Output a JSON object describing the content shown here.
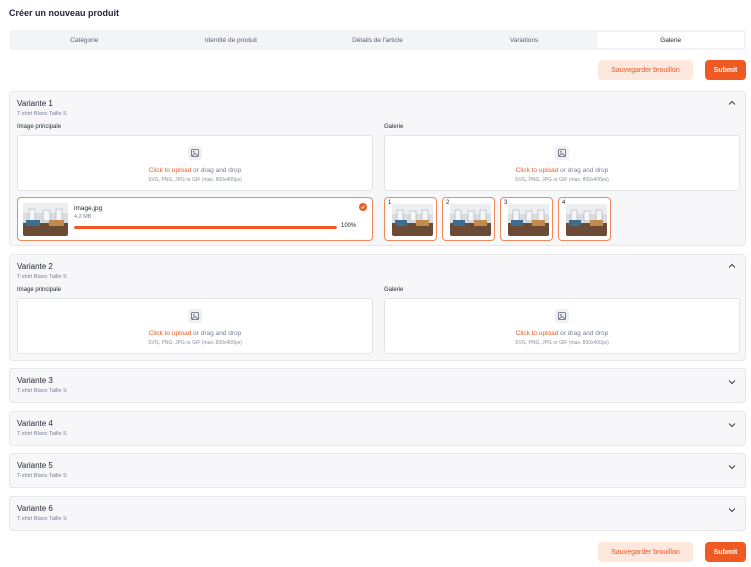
{
  "page": {
    "title": "Créer un nouveau produit"
  },
  "tabs": [
    "Catégorie",
    "Identité de produit",
    "Détails de l'article",
    "Variations",
    "Galerie"
  ],
  "actions": {
    "draft": "Sauvegarder brouillon",
    "submit": "Submit"
  },
  "upload": {
    "cta": "Click to upload",
    "rest": " or drag and drop",
    "hint": "SVG, PNG, JPG or GIF (max. 800x400px)"
  },
  "labels": {
    "main_image": "Image principale",
    "gallery": "Galerie"
  },
  "variants": [
    {
      "title": "Variante 1",
      "subtitle": "T-shirt Blanc Taille S",
      "file": {
        "name": "image.jpg",
        "size": "4.2 MB",
        "progress_percent": 100,
        "progress_label": "100%"
      },
      "gallery_numbers": [
        "1",
        "2",
        "3",
        "4"
      ]
    },
    {
      "title": "Variante 2",
      "subtitle": "T-shirt Blanc Taille S"
    },
    {
      "title": "Variante 3",
      "subtitle": "T-shirt Blanc Taille S"
    },
    {
      "title": "Variante 4",
      "subtitle": "T-shirt Blanc Taille S"
    },
    {
      "title": "Variante 5",
      "subtitle": "T-shirt Blanc Taille S"
    },
    {
      "title": "Variante 6",
      "subtitle": "T-shirt Blanc Taille S"
    }
  ],
  "colors": {
    "accent": "#f05a22",
    "accent_soft": "#fde8de",
    "border_accent": "#f08a5d"
  },
  "icons": {
    "expanded": "chevron-up-icon",
    "collapsed": "chevron-down-icon",
    "upload": "image-icon",
    "done": "check-circle-icon"
  }
}
